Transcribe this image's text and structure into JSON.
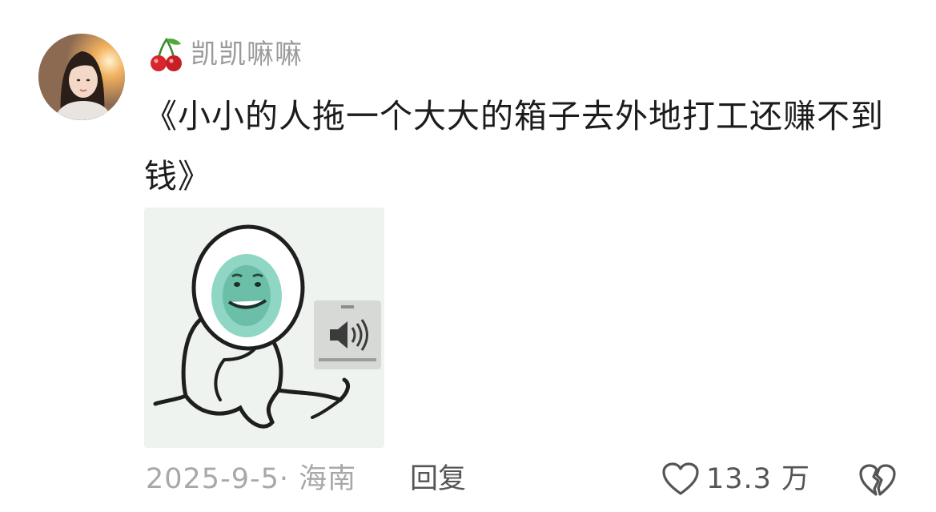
{
  "comment": {
    "username": "凯凯嘛嘛",
    "username_badge_icon": "cherry-icon",
    "text": "《小小的人拖一个大大的箱子去外地打工还赚不到钱》",
    "sticker_icon": "speaker-volume-icon"
  },
  "footer": {
    "date_location": "2025-9-5· 海南",
    "reply_label": "回复",
    "like_icon": "heart-outline-icon",
    "like_count": "13.3 万",
    "dislike_icon": "broken-heart-icon"
  },
  "colors": {
    "text_primary": "#1c1c1c",
    "text_secondary": "#9a9a9a",
    "action_text": "#555555",
    "cherry_red": "#d8262e",
    "cherry_stem": "#3e8a2e"
  }
}
